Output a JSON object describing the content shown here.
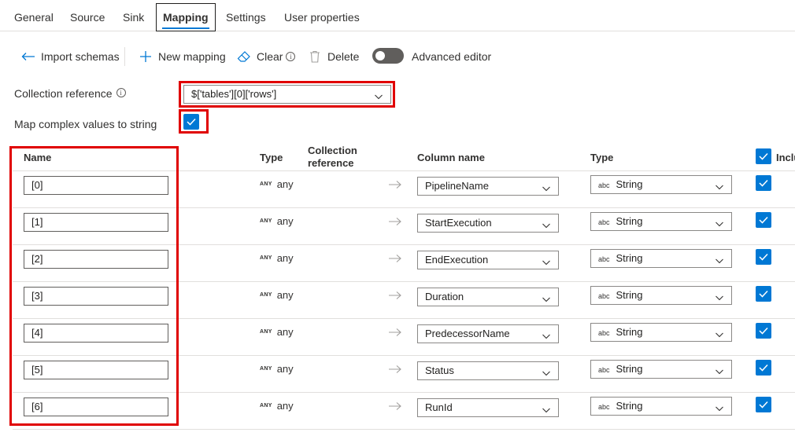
{
  "tabs": [
    {
      "label": "General"
    },
    {
      "label": "Source"
    },
    {
      "label": "Sink"
    },
    {
      "label": "Mapping",
      "active": true
    },
    {
      "label": "Settings"
    },
    {
      "label": "User properties"
    }
  ],
  "toolbar": {
    "import_schemas": "Import schemas",
    "new_mapping": "New mapping",
    "clear": "Clear",
    "delete": "Delete",
    "advanced_editor": "Advanced editor",
    "advanced_editor_on": false
  },
  "settings": {
    "collection_reference_label": "Collection reference",
    "collection_reference_value": "$['tables'][0]['rows']",
    "map_complex_label": "Map complex values to string",
    "map_complex_checked": true
  },
  "table": {
    "headers": {
      "name": "Name",
      "type": "Type",
      "collection_reference": "Collection reference",
      "column_name": "Column name",
      "sink_type": "Type",
      "include": "Inclu"
    },
    "rows": [
      {
        "name": "[0]",
        "type_badge": "ANY",
        "type": "any",
        "column": "PipelineName",
        "sink_type_badge": "abc",
        "sink_type": "String",
        "include": true
      },
      {
        "name": "[1]",
        "type_badge": "ANY",
        "type": "any",
        "column": "StartExecution",
        "sink_type_badge": "abc",
        "sink_type": "String",
        "include": true
      },
      {
        "name": "[2]",
        "type_badge": "ANY",
        "type": "any",
        "column": "EndExecution",
        "sink_type_badge": "abc",
        "sink_type": "String",
        "include": true
      },
      {
        "name": "[3]",
        "type_badge": "ANY",
        "type": "any",
        "column": "Duration",
        "sink_type_badge": "abc",
        "sink_type": "String",
        "include": true
      },
      {
        "name": "[4]",
        "type_badge": "ANY",
        "type": "any",
        "column": "PredecessorName",
        "sink_type_badge": "abc",
        "sink_type": "String",
        "include": true
      },
      {
        "name": "[5]",
        "type_badge": "ANY",
        "type": "any",
        "column": "Status",
        "sink_type_badge": "abc",
        "sink_type": "String",
        "include": true
      },
      {
        "name": "[6]",
        "type_badge": "ANY",
        "type": "any",
        "column": "RunId",
        "sink_type_badge": "abc",
        "sink_type": "String",
        "include": true
      }
    ]
  },
  "colors": {
    "accent": "#0078d4",
    "highlight_box": "#e00000",
    "toggle_off": "#605e5c"
  }
}
